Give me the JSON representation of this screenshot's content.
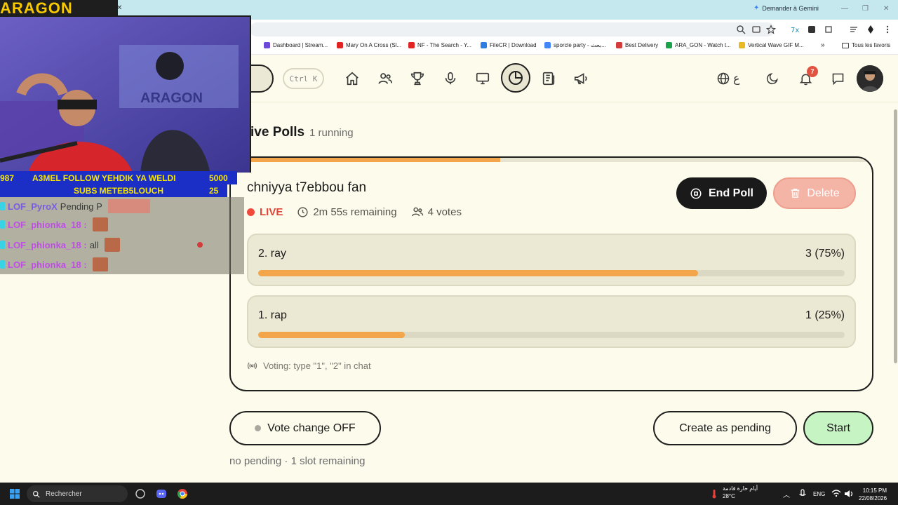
{
  "browser": {
    "gemini_label": "Demander à Gemini",
    "bookmarks": [
      {
        "label": "Dashboard | Stream...",
        "color": "#6d4bd6"
      },
      {
        "label": "Mary On A Cross (Sl...",
        "color": "#e02424"
      },
      {
        "label": "NF - The Search - Y...",
        "color": "#e02424"
      },
      {
        "label": "FileCR | Download",
        "color": "#2f7de1"
      },
      {
        "label": "sporcle party - بحث...",
        "color": "#4285f4"
      },
      {
        "label": "Best Delivery",
        "color": "#d43b3b"
      },
      {
        "label": "ARA_GON - Watch t...",
        "color": "#1aa34a"
      },
      {
        "label": "Vertical Wave GIF M...",
        "color": "#e8b923"
      }
    ],
    "bookmarks_more": "»",
    "all_bookmarks": "Tous les favoris"
  },
  "header": {
    "shortcut": "Ctrl K",
    "nav_icons": [
      "home-icon",
      "users-icon",
      "trophy-icon",
      "microphone-icon",
      "monitor-icon",
      "polls-icon",
      "news-icon",
      "megaphone-icon"
    ],
    "lang_label": "ع",
    "notification_count": "7"
  },
  "section": {
    "title": "ive Polls",
    "subtitle": "1 running"
  },
  "poll": {
    "title": "chniyya t7ebbou fan",
    "status": "LIVE",
    "remaining": "2m 55s remaining",
    "votes": "4 votes",
    "time_progress": 0.42,
    "end_label": "End Poll",
    "delete_label": "Delete",
    "options": [
      {
        "label": "2. ray",
        "count": "3 (75%)",
        "share": 0.75
      },
      {
        "label": "1. rap",
        "count": "1 (25%)",
        "share": 0.25
      }
    ],
    "voting_hint": "Voting: type \"1\", \"2\" in chat"
  },
  "controls": {
    "vote_change": "Vote change OFF",
    "create_pending": "Create as pending",
    "start": "Start",
    "status_line": "no pending · 1 slot remaining"
  },
  "overlay": {
    "logo_text": "ARAGON",
    "webcam_text": "ARAGON",
    "ticker_line1_left": "987",
    "ticker_line1": "A3MEL FOLLOW YEHDIK YA WELDI",
    "ticker_line1_right": "5000",
    "ticker_line2": "SUBS METEB5LOUCH",
    "ticker_line2_right": "25",
    "chat": [
      {
        "user": "LOF_PyroX",
        "overlap": "Pending P"
      },
      {
        "user": "LOF_phionka_18 :",
        "overlap": ""
      },
      {
        "user": "LOF_phionka_18 :",
        "overlap": "all"
      },
      {
        "user": "LOF_phionka_18 :",
        "overlap": ""
      }
    ]
  },
  "taskbar": {
    "search": "Rechercher",
    "weather_text": "أيام حارة قادمة",
    "temperature": "28°C",
    "lang": "ENG",
    "time": "10:15 PM",
    "date": "22/08/2026"
  }
}
